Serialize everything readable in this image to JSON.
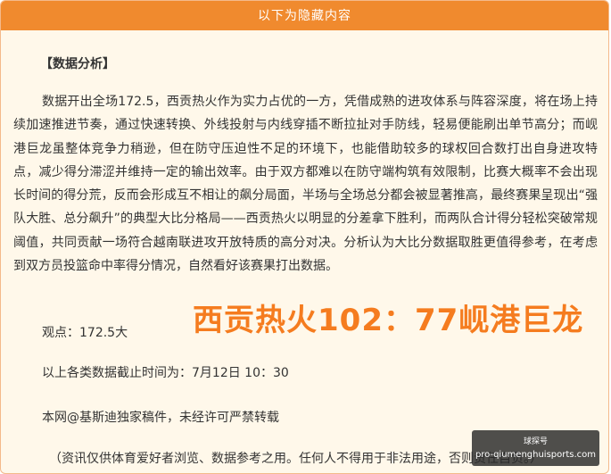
{
  "header": {
    "title": "以下为隐藏内容"
  },
  "article": {
    "section_title": "【数据分析】",
    "paragraph": "数据开出全场172.5，西贡热火作为实力占优的一方，凭借成熟的进攻体系与阵容深度，将在场上持续加速推进节奏，通过快速转换、外线投射与内线穿插不断拉扯对手防线，轻易便能刷出单节高分；而岘港巨龙虽整体竞争力稍逊，但在防守压迫性不足的环境下，也能借助较多的球权回合数打出自身进攻特点，减少得分滞涩并维持一定的输出效率。由于双方都难以在防守端构筑有效限制，比赛大概率不会出现长时间的得分荒，反而会形成互不相让的飙分局面，半场与全场总分都会被显著推高，最终赛果呈现出“强队大胜、总分飙升”的典型大比分格局——西贡热火以明显的分差拿下胜利，而两队合计得分轻松突破常规阈值，共同贡献一场符合越南联进攻开放特质的高分对决。分析认为大比分数据取胜更值得参考，在考虑到双方员投篮命中率得分情况，自然看好该赛果打出数据。",
    "view": "观点：172.5大",
    "deadline": "以上各类数据截止时间为：7月12日 10：30",
    "copyright": "本网@基斯迪独家稿件，未经许可严禁转载",
    "disclaimer": "（资讯仅供体育爱好者浏览、数据参考之用。任何人不得用于非法用途，否则责任自负。）"
  },
  "overlay": {
    "score_text": "西贡热火102：77岘港巨龙"
  },
  "watermark": {
    "top": "球探号",
    "url": "pro-qiumenghuisports.com"
  },
  "colors": {
    "header_bg": "#f08a2e",
    "panel_bg": "#fff8ea",
    "score": "#f57c1f"
  }
}
